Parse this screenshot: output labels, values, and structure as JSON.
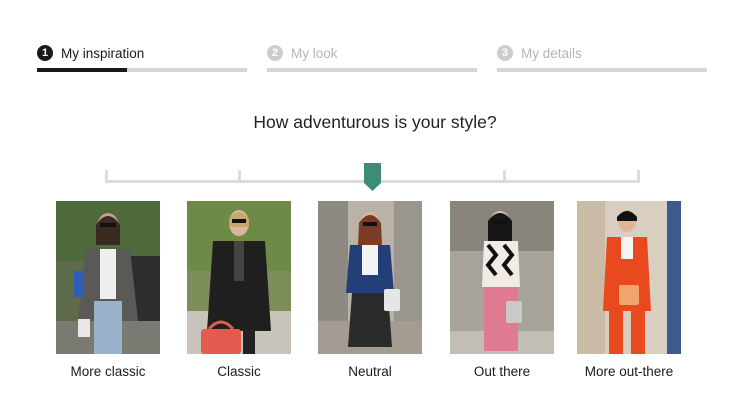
{
  "steps": [
    {
      "number": "1",
      "label": "My inspiration",
      "state": "active",
      "progress": 0.43
    },
    {
      "number": "2",
      "label": "My look",
      "state": "inactive",
      "progress": 0
    },
    {
      "number": "3",
      "label": "My details",
      "state": "inactive",
      "progress": 0
    }
  ],
  "question": "How adventurous is your style?",
  "slider": {
    "selected_index": 2,
    "handle_color": "#3d8c78",
    "positions": 5
  },
  "options": [
    {
      "label": "More classic"
    },
    {
      "label": "Classic"
    },
    {
      "label": "Neutral"
    },
    {
      "label": "Out there"
    },
    {
      "label": "More out-there"
    }
  ],
  "colors": {
    "accent": "#3d8c78",
    "text": "#1a1a1a",
    "muted": "#b5b5b5",
    "track": "#d6d6d6"
  }
}
